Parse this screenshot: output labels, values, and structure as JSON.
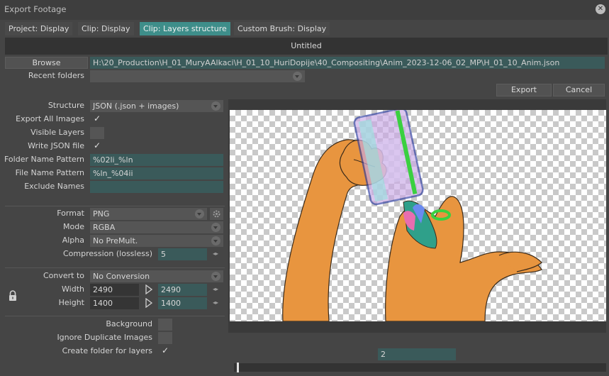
{
  "window": {
    "title": "Export Footage"
  },
  "tabs": [
    {
      "label": "Project: Display"
    },
    {
      "label": "Clip: Display"
    },
    {
      "label": "Clip: Layers structure"
    },
    {
      "label": "Custom Brush: Display"
    }
  ],
  "document_name": "Untitled",
  "browse": {
    "label": "Browse",
    "path": "H:\\20_Production\\H_01_MuryAAlkaci\\H_01_10_HuriDopije\\40_Compositing\\Anim_2023-12-06_02_MP\\H_01_10_Anim.json"
  },
  "recent_folders": {
    "label": "Recent folders",
    "value": ""
  },
  "actions": {
    "export": "Export",
    "cancel": "Cancel"
  },
  "settings": {
    "structure": {
      "label": "Structure",
      "value": "JSON (.json + images)"
    },
    "export_all_images": {
      "label": "Export All Images",
      "checked": "✓"
    },
    "visible_layers": {
      "label": "Visible Layers"
    },
    "write_json": {
      "label": "Write JSON file",
      "checked": "✓"
    },
    "folder_name_pattern": {
      "label": "Folder Name Pattern",
      "value": "%02li_%ln"
    },
    "file_name_pattern": {
      "label": "File Name Pattern",
      "value": "%ln_%04ii"
    },
    "exclude_names": {
      "label": "Exclude Names",
      "value": ""
    },
    "format": {
      "label": "Format",
      "value": "PNG"
    },
    "mode": {
      "label": "Mode",
      "value": "RGBA"
    },
    "alpha": {
      "label": "Alpha",
      "value": "No PreMult."
    },
    "compression": {
      "label": "Compression (lossless)",
      "value": "5"
    },
    "convert_to": {
      "label": "Convert to",
      "value": "No Conversion"
    },
    "width": {
      "label": "Width",
      "source": "2490",
      "target": "2490"
    },
    "height": {
      "label": "Height",
      "source": "1400",
      "target": "1400"
    },
    "background": {
      "label": "Background"
    },
    "ignore_duplicates": {
      "label": "Ignore Duplicate Images"
    },
    "create_folder": {
      "label": "Create folder for layers",
      "checked": "✓"
    }
  },
  "preview": {
    "frame": "2",
    "timeline_position": 0.0
  },
  "colors": {
    "accent": "#3e8e8a",
    "field": "#3a5a5a",
    "skin": "#e8953f"
  }
}
